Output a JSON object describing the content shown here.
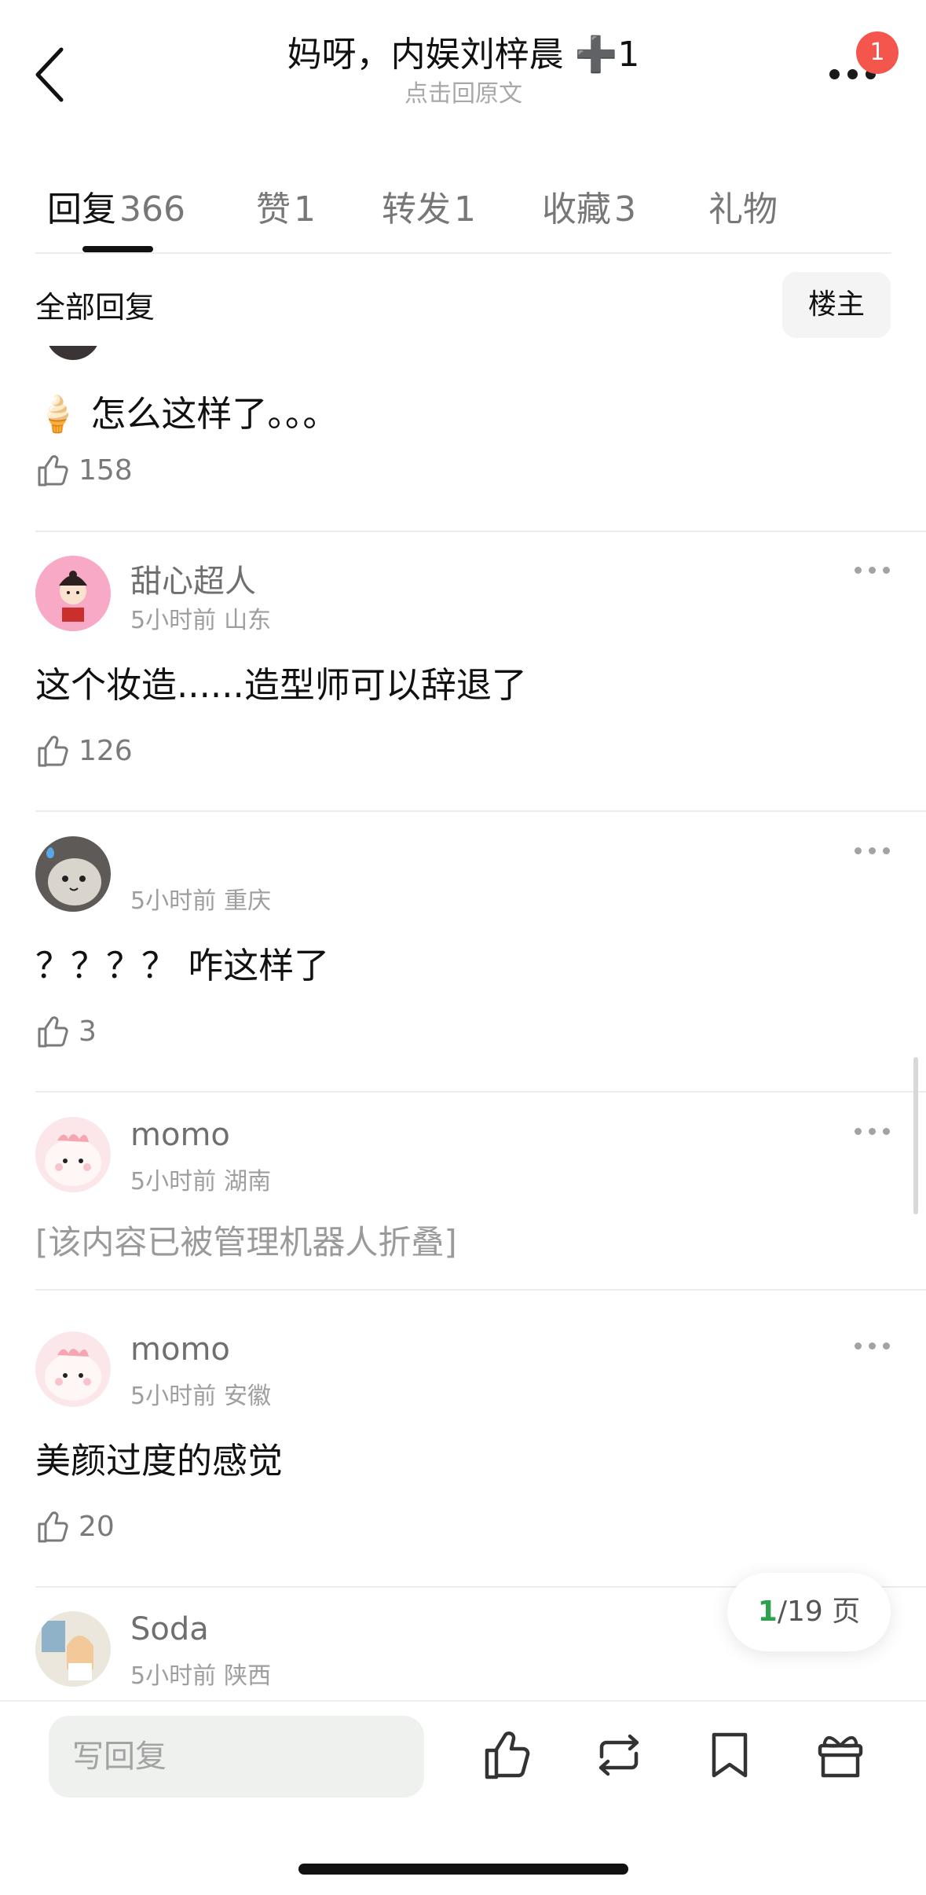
{
  "header": {
    "title": "妈呀，内娱刘梓晨 ➕1",
    "subtitle": "点击回原文",
    "badge_count": "1"
  },
  "tabs": [
    {
      "label": "回复",
      "count": "366",
      "active": true
    },
    {
      "label": "赞",
      "count": "1"
    },
    {
      "label": "转发",
      "count": "1"
    },
    {
      "label": "收藏",
      "count": "3"
    },
    {
      "label": "礼物",
      "count": ""
    }
  ],
  "filter": {
    "label": "全部回复",
    "owner_button": "楼主"
  },
  "comments": [
    {
      "text": "🍦 怎么这样了。。。",
      "likes": "158"
    },
    {
      "name": "甜心超人",
      "time": "5小时前",
      "location": "山东",
      "text": "这个妆造......造型师可以辞退了",
      "likes": "126"
    },
    {
      "name": "",
      "time": "5小时前",
      "location": "重庆",
      "text": "？？？？ 咋这样了",
      "likes": "3"
    },
    {
      "name": "momo",
      "time": "5小时前",
      "location": "湖南",
      "text": "[该内容已被管理机器人折叠]"
    },
    {
      "name": "momo",
      "time": "5小时前",
      "location": "安徽",
      "text": "美颜过度的感觉",
      "likes": "20"
    },
    {
      "name": "Soda",
      "time": "5小时前",
      "location": "陕西"
    }
  ],
  "pager": {
    "current": "1",
    "total": "/19 页"
  },
  "bottom_bar": {
    "reply_placeholder": "写回复"
  },
  "colors": {
    "accent_green": "#2da14b",
    "badge_red": "#f4564e"
  }
}
